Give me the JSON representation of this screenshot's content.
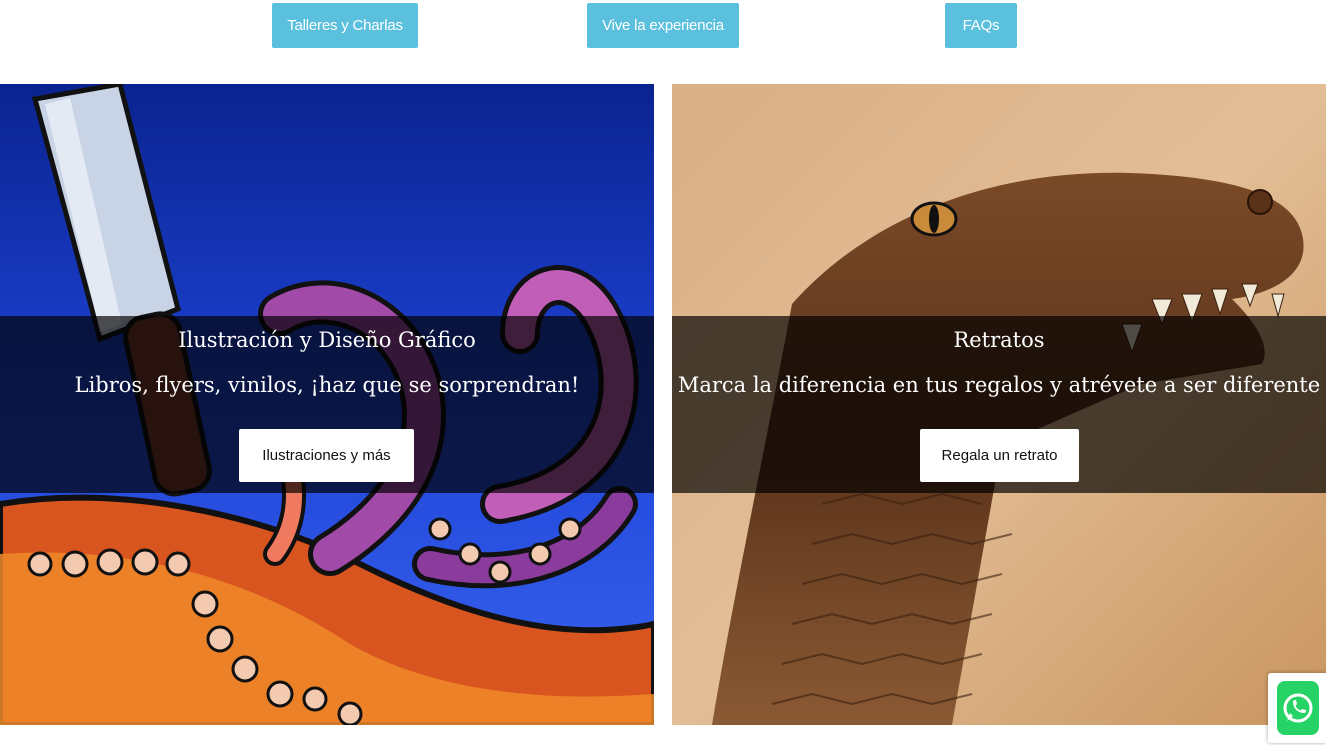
{
  "top_nav": {
    "buttons": [
      {
        "label": "Talleres y Charlas"
      },
      {
        "label": "Vive la experiencia"
      },
      {
        "label": "FAQs"
      }
    ]
  },
  "panels": [
    {
      "title": "Ilustración y Diseño Gráfico",
      "subtitle": "Libros, flyers, vinilos, ¡haz que se sorprendran!",
      "button": "Ilustraciones y más",
      "image": "octopus-illustration"
    },
    {
      "title": "Retratos",
      "subtitle": "Marca la diferencia en tus regalos y atrévete a ser diferente",
      "button": "Regala un retrato",
      "image": "alligator-pyrography"
    }
  ],
  "floating": {
    "icon": "whatsapp-icon"
  },
  "colors": {
    "nav_button": "#5bc0de",
    "overlay": "rgba(0,0,0,0.68)",
    "whatsapp": "#25d366"
  }
}
